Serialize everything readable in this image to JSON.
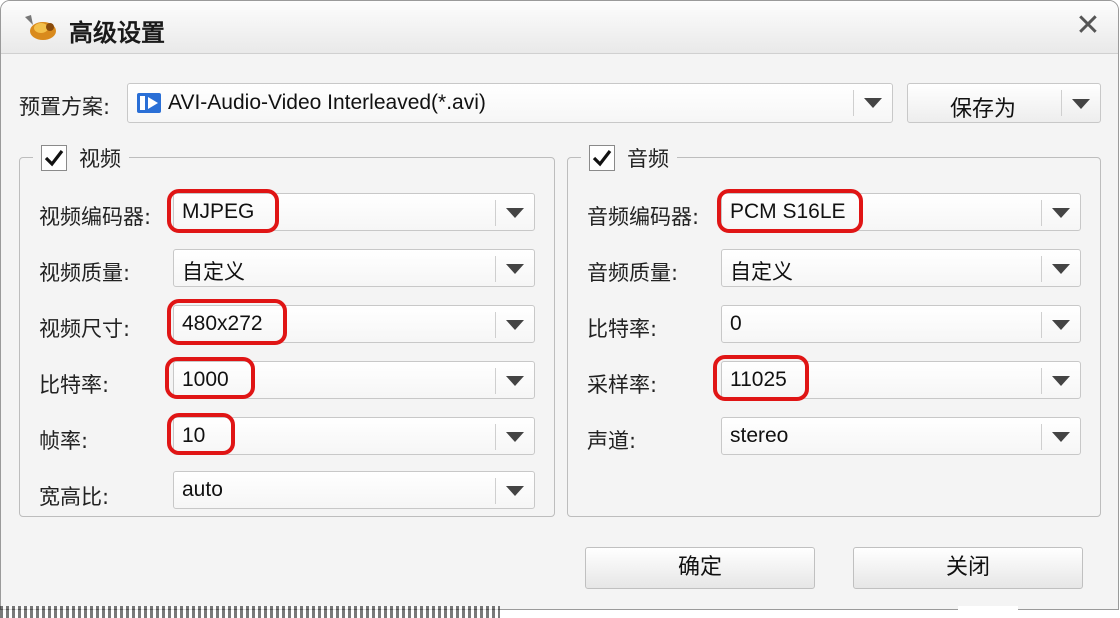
{
  "window": {
    "title": "高级设置",
    "title_icon": "app-logo-icon",
    "close_icon": "close-icon",
    "close_glyph": "✕"
  },
  "preset": {
    "label": "预置方案:",
    "value": "AVI-Audio-Video Interleaved(*.avi)",
    "icon": "video-file-icon",
    "save_as_label": "保存为"
  },
  "video": {
    "enabled": true,
    "group_label": "视频",
    "fields": [
      {
        "label": "视频编码器:",
        "value": "MJPEG",
        "highlighted": true
      },
      {
        "label": "视频质量:",
        "value": "自定义",
        "highlighted": false
      },
      {
        "label": "视频尺寸:",
        "value": "480x272",
        "highlighted": true
      },
      {
        "label": "比特率:",
        "value": "1000",
        "highlighted": true
      },
      {
        "label": "帧率:",
        "value": "10",
        "highlighted": true
      },
      {
        "label": "宽高比:",
        "value": "auto",
        "highlighted": false
      }
    ]
  },
  "audio": {
    "enabled": true,
    "group_label": "音频",
    "fields": [
      {
        "label": "音频编码器:",
        "value": "PCM S16LE",
        "highlighted": true
      },
      {
        "label": "音频质量:",
        "value": "自定义",
        "highlighted": false
      },
      {
        "label": "比特率:",
        "value": "0",
        "highlighted": false
      },
      {
        "label": "采样率:",
        "value": "11025",
        "highlighted": true
      },
      {
        "label": "声道:",
        "value": "stereo",
        "highlighted": false
      }
    ]
  },
  "buttons": {
    "ok_label": "确定",
    "close_label": "关闭"
  },
  "colors": {
    "highlight": "#e01515",
    "dialog_bg": "#f4f4f4"
  }
}
